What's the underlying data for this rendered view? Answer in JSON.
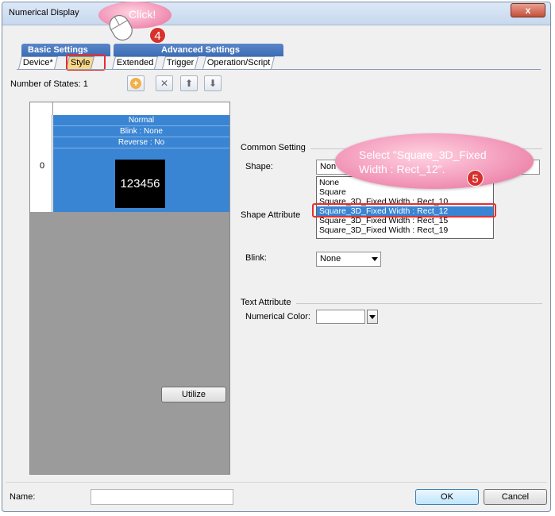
{
  "window": {
    "title": "Numerical Display",
    "close_glyph": "x"
  },
  "groups": {
    "basic": "Basic Settings",
    "advanced": "Advanced Settings"
  },
  "tabs": [
    {
      "label": "Device*"
    },
    {
      "label": "Style",
      "active": true
    },
    {
      "label": "Extended"
    },
    {
      "label": "Trigger"
    },
    {
      "label": "Operation/Script"
    }
  ],
  "states": {
    "label": "Number of States: 1",
    "toolbar_icons": [
      "add-icon",
      "delete-icon",
      "move-up-icon",
      "move-down-icon"
    ],
    "rows": [
      {
        "index": "0",
        "lines": [
          "Normal",
          "Blink : None",
          "Reverse : No"
        ],
        "preview": "123456"
      }
    ],
    "utilize_label": "Utilize"
  },
  "common": {
    "header": "Common Setting",
    "shape_label": "Shape:",
    "shape_value": "Non",
    "options": [
      "None",
      "Square",
      "Square_3D_Fixed Width : Rect_10",
      "Square_3D_Fixed Width : Rect_12",
      "Square_3D_Fixed Width : Rect_15",
      "Square_3D_Fixed Width : Rect_19"
    ],
    "selected_index": 3
  },
  "shape_attr": {
    "header": "Shape Attribute",
    "blink_label": "Blink:",
    "blink_value": "None"
  },
  "text_attr": {
    "header": "Text Attribute",
    "color_label": "Numerical Color:"
  },
  "footer": {
    "name_label": "Name:",
    "name_value": "",
    "ok": "OK",
    "cancel": "Cancel"
  },
  "callouts": {
    "click_text": "Click!",
    "click_step": "4",
    "select_text": "Select \"Square_3D_Fixed Width : Rect_12\".",
    "select_step": "5"
  },
  "colors": {
    "accent": "#3a85d3",
    "highlight": "#e5302d",
    "callout": "#f39bbb",
    "active_tab": "#f8d888"
  }
}
